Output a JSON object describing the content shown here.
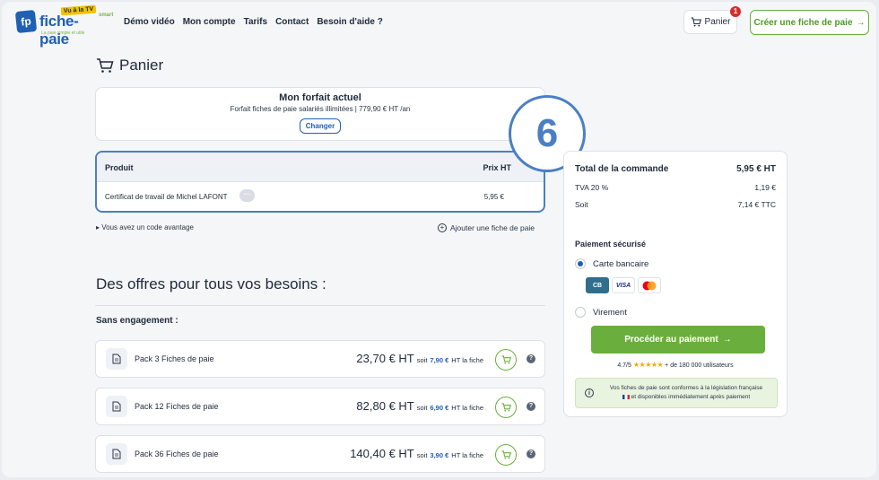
{
  "header": {
    "logo_badge": "Vu à la TV",
    "logo_name": "fiche-paie",
    "logo_smart": "smart",
    "logo_tagline": "La paie simple et utile",
    "logo_fp": "fp",
    "nav": [
      "Démo vidéo",
      "Mon compte",
      "Tarifs",
      "Contact",
      "Besoin d'aide ?"
    ],
    "cart_label": "Panier",
    "cart_count": "1",
    "create_label": "Créer une fiche de paie"
  },
  "page": {
    "title": "Panier"
  },
  "forfait": {
    "title": "Mon forfait actuel",
    "details": "Forfait fiches de paie salariés illimitées | 779,90 € HT /an",
    "change_label": "Changer"
  },
  "cart_table": {
    "col_product": "Produit",
    "col_price": "Prix HT",
    "rows": [
      {
        "product": "Certificat de travail de Michel LAFONT",
        "menu": "···",
        "price": "5,95 €"
      }
    ]
  },
  "promo_label": "Vous avez un code avantage",
  "add_slip_label": "Ajouter une fiche de paie",
  "step_number": "6",
  "offers": {
    "title": "Des offres pour tous vos besoins :",
    "subtitle": "Sans engagement :",
    "packs": [
      {
        "name": "Pack 3 Fiches de paie",
        "price": "23,70 € HT",
        "soit": "soit",
        "unit_price": "7,90 €",
        "unit_suffix": "HT la fiche"
      },
      {
        "name": "Pack 12 Fiches de paie",
        "price": "82,80 € HT",
        "soit": "soit",
        "unit_price": "6,90 €",
        "unit_suffix": "HT la fiche"
      },
      {
        "name": "Pack 36 Fiches de paie",
        "price": "140,40 € HT",
        "soit": "soit",
        "unit_price": "3,90 €",
        "unit_suffix": "HT la fiche"
      }
    ]
  },
  "summary": {
    "total_label": "Total de la commande",
    "total_value": "5,95 € HT",
    "tva_label": "TVA 20 %",
    "tva_value": "1,19 €",
    "soit_label": "Soit",
    "soit_value": "7,14 € TTC",
    "payment_title": "Paiement sécurisé",
    "card_option": "Carte bancaire",
    "card_brands": [
      "CB",
      "VISA",
      "mastercard"
    ],
    "transfer_option": "Virement",
    "pay_button": "Procéder au paiement",
    "rating_score": "4.7/5",
    "rating_stars": "★★★★★",
    "rating_text": "+ de 180 000 utilisateurs",
    "legal_line1": "Vos fiches de paie sont conformes à la législation française",
    "legal_line2": "et disponibles immédiatement après paiement"
  },
  "colors": {
    "brand_blue": "#1f5fb4",
    "brand_green": "#6aaf3d",
    "badge_red": "#d82c2c",
    "step_blue": "#4b7fc4"
  }
}
